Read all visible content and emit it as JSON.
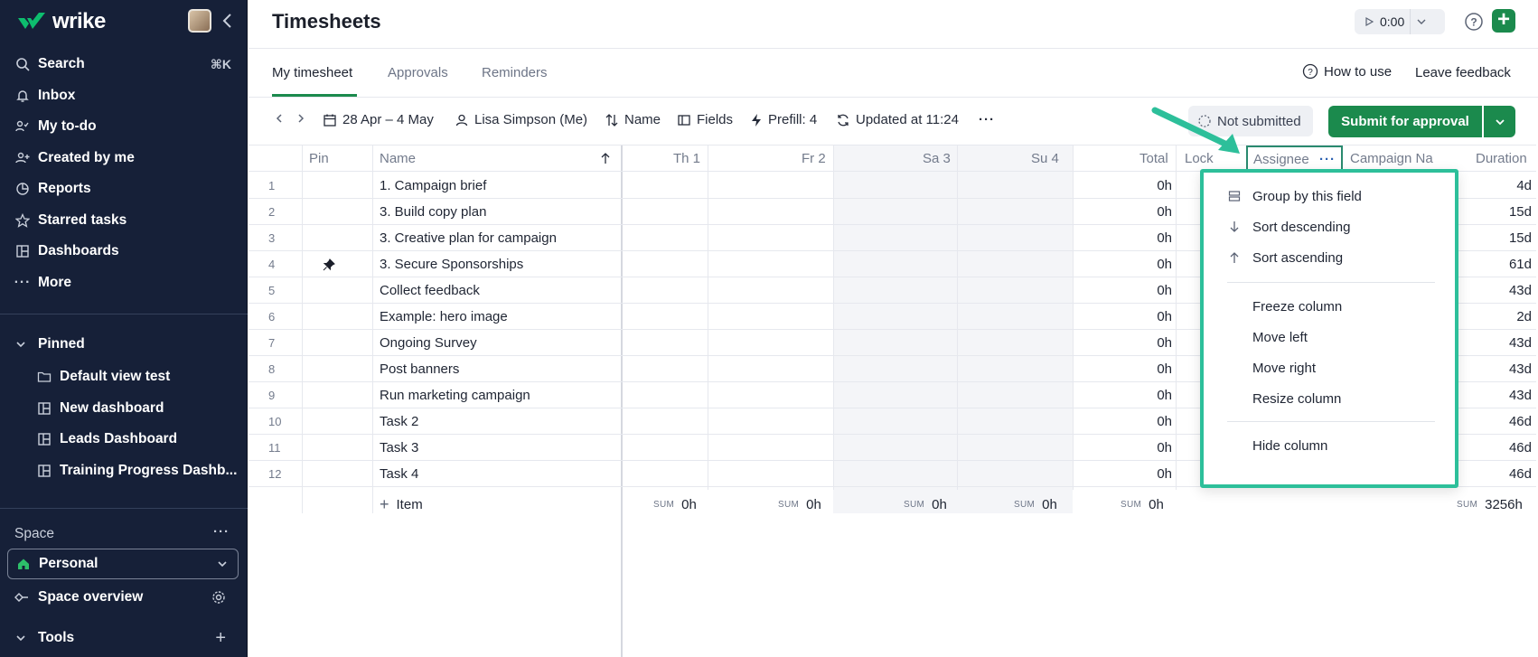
{
  "app": {
    "name": "wrike"
  },
  "sidebar": {
    "nav": [
      {
        "label": "Search",
        "icon": "search-icon",
        "shortcut": "⌘K"
      },
      {
        "label": "Inbox",
        "icon": "bell-icon"
      },
      {
        "label": "My to-do",
        "icon": "todo-icon"
      },
      {
        "label": "Created by me",
        "icon": "user-plus-icon"
      },
      {
        "label": "Reports",
        "icon": "reports-icon"
      },
      {
        "label": "Starred tasks",
        "icon": "star-icon"
      },
      {
        "label": "Dashboards",
        "icon": "dashboard-icon"
      },
      {
        "label": "More",
        "icon": "more-icon"
      }
    ],
    "pinned_label": "Pinned",
    "pinned": [
      {
        "label": "Default view test",
        "icon": "folder-icon"
      },
      {
        "label": "New dashboard",
        "icon": "dashboard-icon"
      },
      {
        "label": "Leads Dashboard",
        "icon": "dashboard-icon"
      },
      {
        "label": "Training Progress Dashb...",
        "icon": "dashboard-icon"
      }
    ],
    "space_label": "Space",
    "space_selected": "Personal",
    "space_overview": "Space overview",
    "tools": "Tools"
  },
  "header": {
    "title": "Timesheets",
    "timer": "0:00"
  },
  "tabs": [
    {
      "label": "My timesheet",
      "active": true
    },
    {
      "label": "Approvals",
      "active": false
    },
    {
      "label": "Reminders",
      "active": false
    }
  ],
  "tabbar_right": {
    "how_to": "How to use",
    "leave_feedback": "Leave feedback"
  },
  "toolbar": {
    "date_range": "28 Apr – 4 May",
    "user": "Lisa Simpson (Me)",
    "sort": "Name",
    "fields": "Fields",
    "prefill": "Prefill: 4",
    "updated": "Updated at 11:24",
    "status": "Not submitted",
    "submit": "Submit for approval"
  },
  "columns": {
    "pin": "Pin",
    "name": "Name",
    "th": "Th 1",
    "fr": "Fr 2",
    "sa": "Sa 3",
    "su": "Su 4",
    "total": "Total",
    "lock": "Lock",
    "assignee": "Assignee",
    "campaign": "Campaign Na",
    "duration": "Duration"
  },
  "rows": [
    {
      "num": "1",
      "name": "1. Campaign brief",
      "total": "0h",
      "duration": "4d",
      "pinned": false
    },
    {
      "num": "2",
      "name": "3. Build copy plan",
      "total": "0h",
      "duration": "15d",
      "pinned": false
    },
    {
      "num": "3",
      "name": "3. Creative plan for campaign",
      "total": "0h",
      "duration": "15d",
      "pinned": false
    },
    {
      "num": "4",
      "name": "3. Secure Sponsorships",
      "total": "0h",
      "duration": "61d",
      "pinned": true
    },
    {
      "num": "5",
      "name": "Collect feedback",
      "total": "0h",
      "duration": "43d",
      "pinned": false
    },
    {
      "num": "6",
      "name": "Example: hero image",
      "total": "0h",
      "duration": "2d",
      "pinned": false
    },
    {
      "num": "7",
      "name": "Ongoing Survey",
      "total": "0h",
      "duration": "43d",
      "pinned": false
    },
    {
      "num": "8",
      "name": "Post banners",
      "total": "0h",
      "duration": "43d",
      "pinned": false
    },
    {
      "num": "9",
      "name": "Run marketing campaign",
      "total": "0h",
      "duration": "43d",
      "pinned": false
    },
    {
      "num": "10",
      "name": "Task 2",
      "total": "0h",
      "duration": "46d",
      "pinned": false
    },
    {
      "num": "11",
      "name": "Task 3",
      "total": "0h",
      "duration": "46d",
      "pinned": false
    },
    {
      "num": "12",
      "name": "Task 4",
      "total": "0h",
      "duration": "46d",
      "pinned": false
    }
  ],
  "footer": {
    "add_item": "Item",
    "sum_label": "SUM",
    "th": "0h",
    "fr": "0h",
    "sa": "0h",
    "su": "0h",
    "total": "0h",
    "duration": "3256h"
  },
  "column_menu": {
    "items": [
      {
        "label": "Group by this field",
        "icon": "group-icon"
      },
      {
        "label": "Sort descending",
        "icon": "arrow-down-icon"
      },
      {
        "label": "Sort ascending",
        "icon": "arrow-up-icon"
      },
      {
        "label": "Freeze column",
        "icon": ""
      },
      {
        "label": "Move left",
        "icon": ""
      },
      {
        "label": "Move right",
        "icon": ""
      },
      {
        "label": "Resize column",
        "icon": ""
      },
      {
        "label": "Hide column",
        "icon": ""
      }
    ]
  },
  "colors": {
    "sidebar": "#162038",
    "accent": "#1b8a4d",
    "highlight": "#2dbf9a"
  }
}
